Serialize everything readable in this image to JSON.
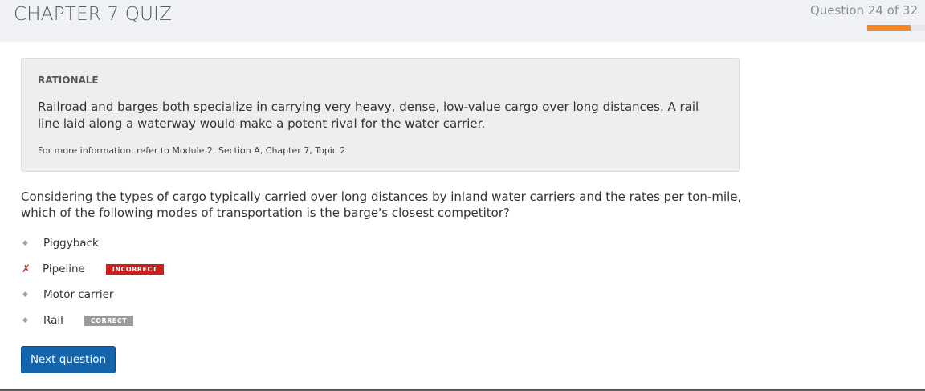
{
  "header": {
    "title": "CHAPTER 7 QUIZ",
    "progress_text": "Question 24 of 32",
    "progress_fraction": 0.75,
    "accent_color": "#f1892d"
  },
  "rationale": {
    "heading": "RATIONALE",
    "body": "Railroad and barges both specialize in carrying very heavy, dense, low-value cargo over long distances. A rail line laid along a waterway would make a potent rival for the water carrier.",
    "reference": "For more information, refer to Module 2, Section A, Chapter 7, Topic 2"
  },
  "question": {
    "text": "Considering the types of cargo typically carried over long distances by inland water carriers and the rates per ton-mile, which of the following modes of transportation is the barge's closest competitor?"
  },
  "answers": [
    {
      "label": "Piggyback",
      "marker": "◆",
      "badge": ""
    },
    {
      "label": "Pipeline",
      "marker": "✗",
      "badge": "INCORRECT",
      "status_color": "#cc1f1a"
    },
    {
      "label": "Motor carrier",
      "marker": "◆",
      "badge": ""
    },
    {
      "label": "Rail",
      "marker": "◆",
      "badge": "CORRECT",
      "status_color": "#9b9b9b"
    }
  ],
  "actions": {
    "next_label": "Next question",
    "button_color": "#1565ad"
  }
}
